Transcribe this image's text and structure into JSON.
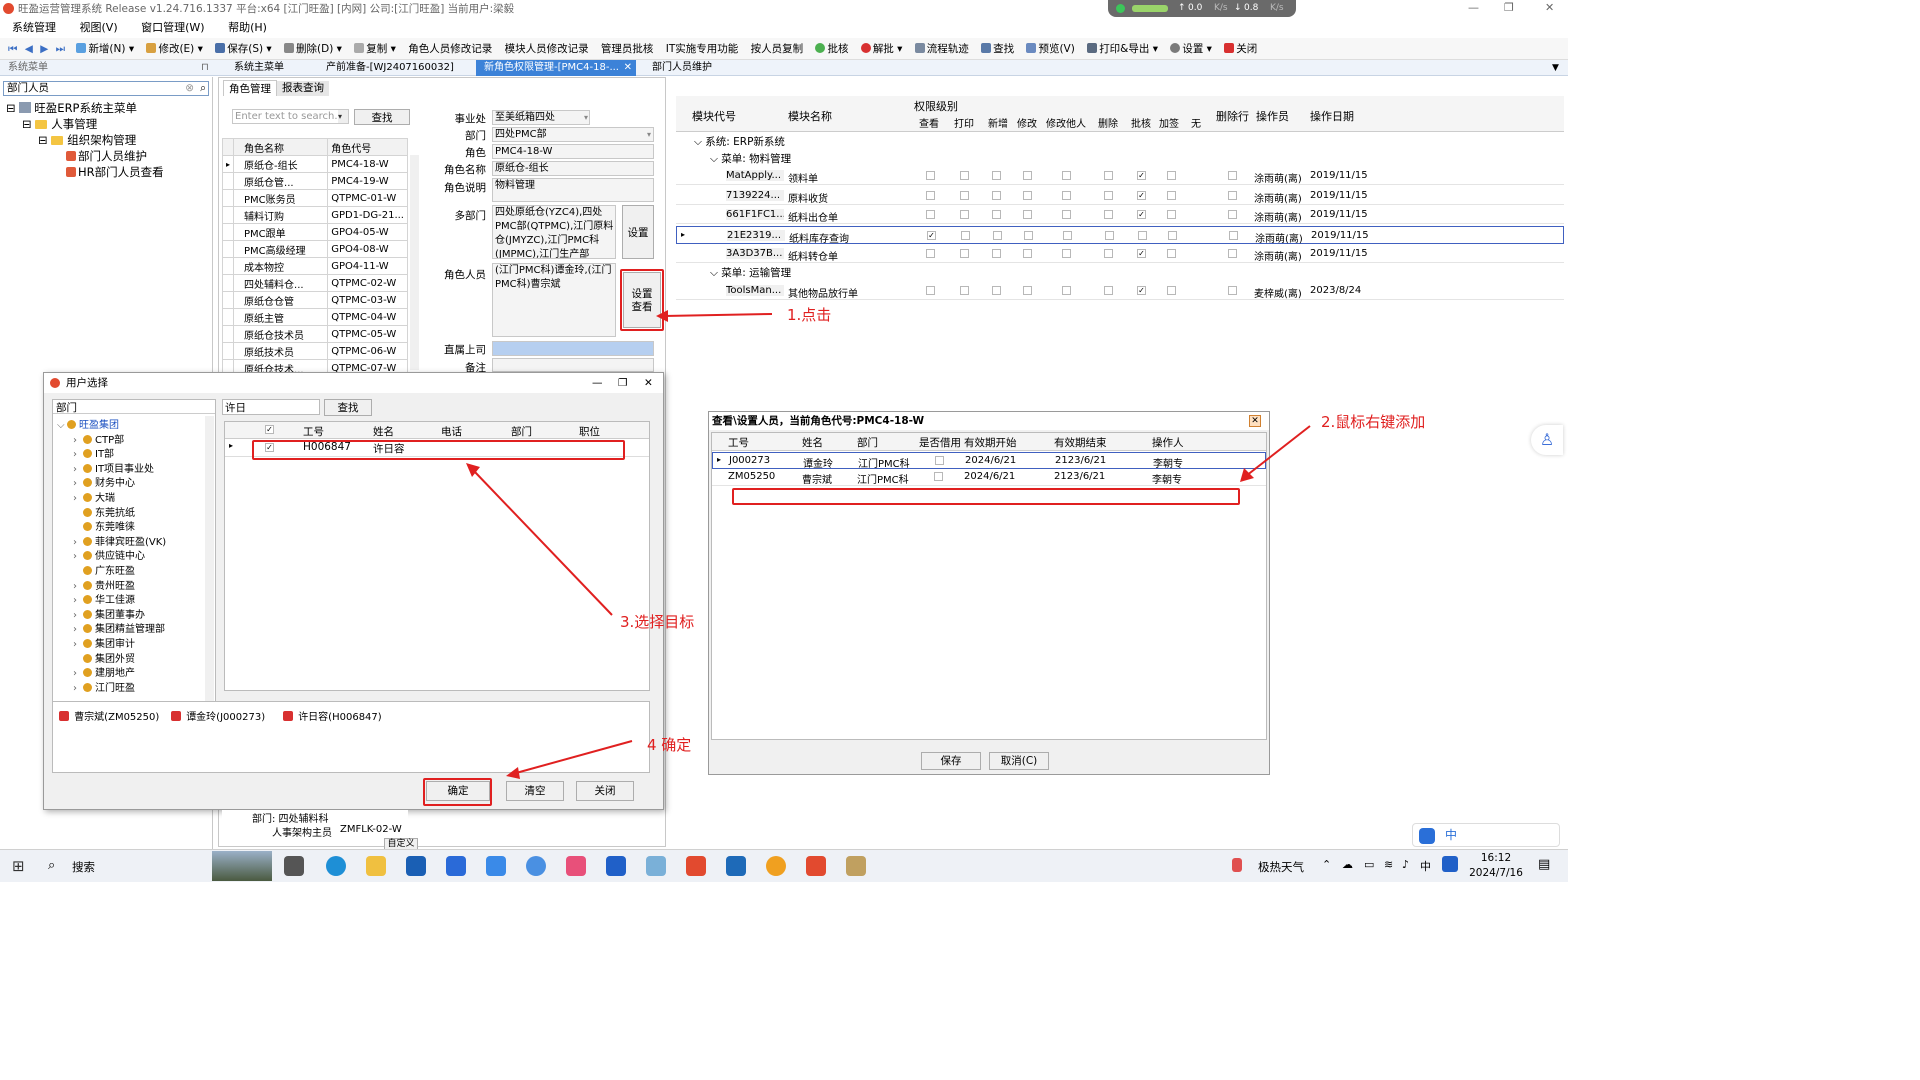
{
  "app": {
    "title": "旺盈运营管理系统 Release v1.24.716.1337 平台:x64  [江门旺盈] [内网] 公司:[江门旺盈] 当前用户:梁毅",
    "net_up": "0.0",
    "net_down": "0.8",
    "net_unit": "K/s"
  },
  "menu": [
    "系统管理",
    "视图(V)",
    "窗口管理(W)",
    "帮助(H)"
  ],
  "toolbar": [
    "新增(N)",
    "修改(E)",
    "保存(S)",
    "删除(D)",
    "复制",
    "角色人员修改记录",
    "模块人员修改记录",
    "管理员批核",
    "IT实施专用功能",
    "按人员复制",
    "批核",
    "解批",
    "流程轨迹",
    "查找",
    "预览(V)",
    "打印&导出",
    "设置",
    "关闭"
  ],
  "tabs": {
    "left_header": "系统菜单",
    "items": [
      "系统主菜单",
      "产前准备-[WJ2407160032]",
      "新角色权限管理-[PMC4-18-...",
      "部门人员维护"
    ]
  },
  "left": {
    "search": "部门人员",
    "tree": [
      "旺盈ERP系统主菜单",
      "人事管理",
      "组织架构管理",
      "部门人员维护",
      "HR部门人员查看"
    ]
  },
  "mid": {
    "tabs": [
      "角色管理",
      "报表查询"
    ],
    "search_placeholder": "Enter text to search...",
    "search_btn": "查找",
    "col_headers": [
      "角色名称",
      "角色代号"
    ],
    "roles": [
      [
        "原纸仓-组长",
        "PMC4-18-W"
      ],
      [
        "原纸仓管...",
        "PMC4-19-W"
      ],
      [
        "PMC账务员",
        "QTPMC-01-W"
      ],
      [
        "辅料订购",
        "GPD1-DG-21..."
      ],
      [
        "PMC跟单",
        "GPO4-05-W"
      ],
      [
        "PMC高级经理",
        "GPO4-08-W"
      ],
      [
        "成本物控",
        "GPO4-11-W"
      ],
      [
        "四处辅料仓...",
        "QTPMC-02-W"
      ],
      [
        "原纸仓仓管",
        "QTPMC-03-W"
      ],
      [
        "原纸主管",
        "QTPMC-04-W"
      ],
      [
        "原纸仓技术员",
        "QTPMC-05-W"
      ],
      [
        "原纸技术员",
        "QTPMC-06-W"
      ],
      [
        "原纸仓技术...",
        "QTPMC-07-W"
      ]
    ],
    "bottom_group": "部门: 四处辅料科",
    "bottom_row": [
      "人事架构主员",
      "ZMFLK-02-W"
    ],
    "bottom_btn": "自定义"
  },
  "form": {
    "labels": [
      "事业处",
      "部门",
      "角色",
      "角色名称",
      "角色说明",
      "多部门",
      "角色人员",
      "直属上司",
      "备注"
    ],
    "bu": "至美纸箱四处",
    "dept": "四处PMC部",
    "role": "PMC4-18-W",
    "role_name": "原纸仓-组长",
    "role_desc": "物料管理",
    "multi_dept": "四处原纸仓(YZC4),四处PMC部(QTPMC),江门原料仓(JMYZC),江门PMC科(JMPMC),江门生产部(JMSCB),五处原纸仓",
    "members": "(江门PMC科)谭金玲,(江门PMC科)曹宗斌",
    "set_btn": "设置",
    "view_btn": "设置\n查看"
  },
  "perm": {
    "headers": [
      "模块代号",
      "模块名称",
      "权限级别",
      "删除行",
      "操作员",
      "操作日期"
    ],
    "levels": [
      "查看",
      "打印",
      "新增",
      "修改",
      "修改他人",
      "删除",
      "批核",
      "加签",
      "无"
    ],
    "sys": "系统: ERP新系统",
    "menu1": "菜单: 物料管理",
    "menu2": "菜单: 运输管理",
    "rows": [
      {
        "code": "MatApply...",
        "name": "领料单",
        "checks": [
          0,
          0,
          0,
          0,
          0,
          0,
          1,
          0
        ],
        "op": "涂雨萌(离)",
        "date": "2019/11/15"
      },
      {
        "code": "7139224...",
        "name": "原料收货",
        "checks": [
          0,
          0,
          0,
          0,
          0,
          0,
          1,
          0
        ],
        "op": "涂雨萌(离)",
        "date": "2019/11/15"
      },
      {
        "code": "661F1FC1...",
        "name": "纸料出仓单",
        "checks": [
          0,
          0,
          0,
          0,
          0,
          0,
          1,
          0
        ],
        "op": "涂雨萌(离)",
        "date": "2019/11/15"
      },
      {
        "code": "21E2319...",
        "name": "纸料库存查询",
        "checks": [
          1,
          0,
          0,
          0,
          0,
          0,
          0,
          0
        ],
        "op": "涂雨萌(离)",
        "date": "2019/11/15"
      },
      {
        "code": "3A3D37B...",
        "name": "纸料转仓单",
        "checks": [
          0,
          0,
          0,
          0,
          0,
          0,
          1,
          0
        ],
        "op": "涂雨萌(离)",
        "date": "2019/11/15"
      },
      {
        "code": "ToolsMan...",
        "name": "其他物品放行单",
        "checks": [
          0,
          0,
          0,
          0,
          0,
          0,
          1,
          0
        ],
        "op": "麦梓威(离)",
        "date": "2023/8/24"
      }
    ]
  },
  "user_dialog": {
    "title": "用户选择",
    "dept_label": "部门",
    "search_value": "许日",
    "search_btn": "查找",
    "tree": [
      "旺盈集团",
      "CTP部",
      "IT部",
      "IT项目事业处",
      "财务中心",
      "大瑞",
      "东莞抗纸",
      "东莞唯徕",
      "菲律宾旺盈(VK)",
      "供应链中心",
      "广东旺盈",
      "贵州旺盈",
      "华工佳源",
      "集团董事办",
      "集团精益管理部",
      "集团审计",
      "集团外贸",
      "建朋地产",
      "江门旺盈"
    ],
    "cols": [
      "工号",
      "姓名",
      "电话",
      "部门",
      "职位"
    ],
    "row": [
      "H006847",
      "许日容",
      "",
      "",
      ""
    ],
    "selected": [
      "曹宗斌(ZM05250)",
      "谭金玲(J000273)",
      "许日容(H006847)"
    ],
    "ok": "确定",
    "clear": "清空",
    "close": "关闭"
  },
  "setup_dialog": {
    "title": "查看\\设置人员，当前角色代号:PMC4-18-W",
    "cols": [
      "工号",
      "姓名",
      "部门",
      "是否借用",
      "有效期开始",
      "有效期结束",
      "操作人"
    ],
    "rows": [
      [
        "J000273",
        "谭金玲",
        "江门PMC科",
        "",
        "2024/6/21",
        "2123/6/21",
        "李朝专"
      ],
      [
        "ZM05250",
        "曹宗斌",
        "江门PMC科",
        "",
        "2024/6/21",
        "2123/6/21",
        "李朝专"
      ]
    ],
    "save": "保存",
    "cancel": "取消(C)"
  },
  "annotations": {
    "a1": "1.点击",
    "a2": "2.鼠标右键添加",
    "a3": "3.选择目标",
    "a4": "4 确定"
  },
  "taskbar": {
    "search": "搜索",
    "weather": "极热天气",
    "time": "16:12",
    "date": "2024/7/16",
    "ime": "中"
  },
  "colors": {
    "accent": "#3c82d8",
    "annotation": "#e02020"
  }
}
